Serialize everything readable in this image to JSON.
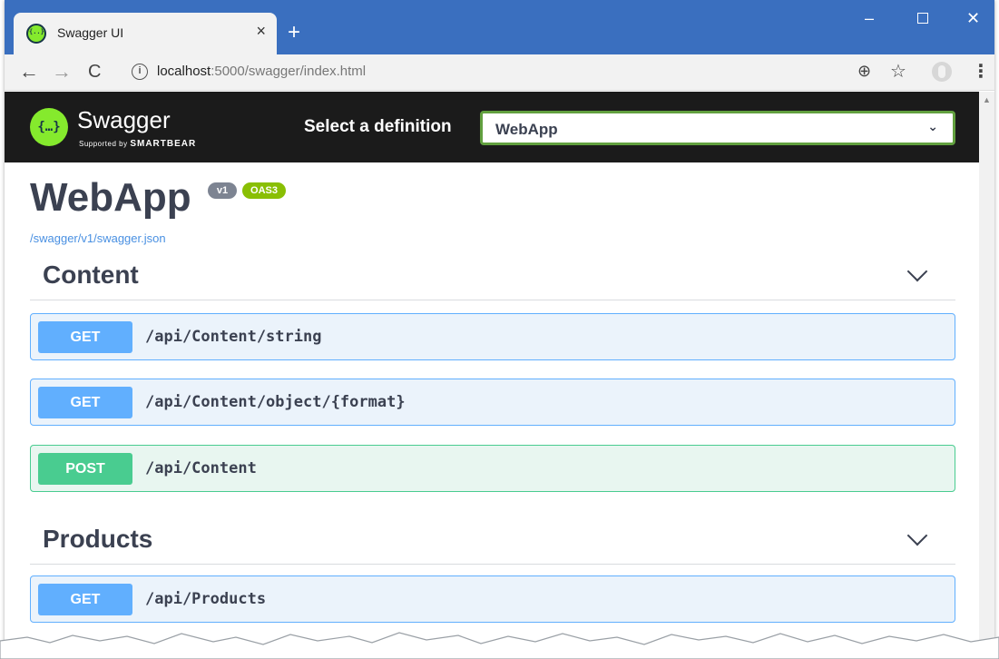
{
  "browser": {
    "tab_title": "Swagger UI",
    "tab_close": "×",
    "new_tab": "+",
    "url_host": "localhost",
    "url_rest": ":5000/swagger/index.html",
    "window_controls": {
      "minimize": "–",
      "close": "✕"
    },
    "nav": {
      "back": "←",
      "forward": "→",
      "reload": "C"
    }
  },
  "topbar": {
    "brand": "Swagger",
    "brand_sub_prefix": "Supported by",
    "brand_sub_company": "SMARTBEAR",
    "definition_label": "Select a definition",
    "definition_value": "WebApp"
  },
  "info": {
    "title": "WebApp",
    "version_badge": "v1",
    "oas_badge": "OAS3",
    "spec_url": "/swagger/v1/swagger.json"
  },
  "sections": [
    {
      "name": "Content",
      "operations": [
        {
          "method": "GET",
          "path": "/api/Content/string"
        },
        {
          "method": "GET",
          "path": "/api/Content/object/{format}"
        },
        {
          "method": "POST",
          "path": "/api/Content"
        }
      ]
    },
    {
      "name": "Products",
      "operations": [
        {
          "method": "GET",
          "path": "/api/Products"
        }
      ]
    }
  ],
  "colors": {
    "get": "#61affe",
    "post": "#49cc90",
    "topbar_bg": "#1b1b1b",
    "browser_frame": "#3a6fbf",
    "swagger_green": "#85ea2d"
  }
}
